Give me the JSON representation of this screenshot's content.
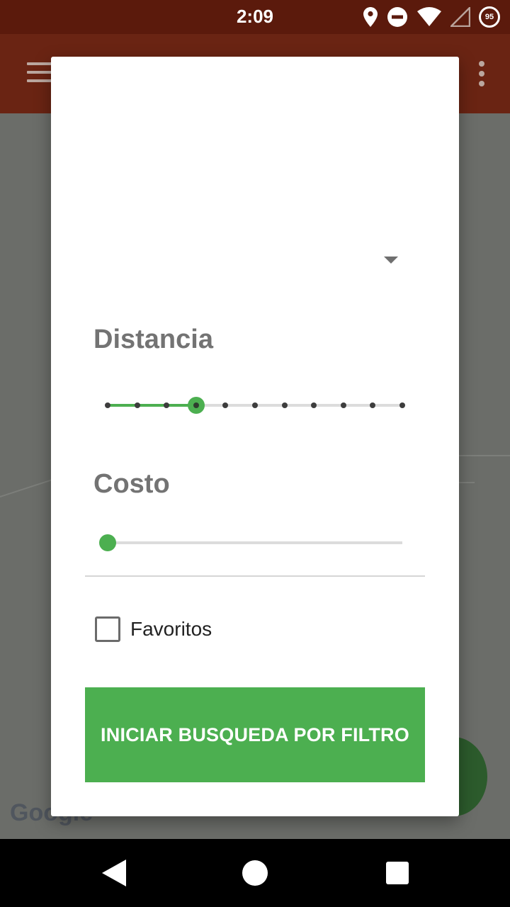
{
  "status_bar": {
    "time": "2:09",
    "icons": [
      "location-icon",
      "do-not-disturb-icon",
      "wifi-icon",
      "cell-signal-icon",
      "battery-icon"
    ],
    "battery_level": "95"
  },
  "app_bar": {
    "menu_icon": "menu-icon",
    "overflow_icon": "more-vert-icon"
  },
  "map": {
    "logo": "Google"
  },
  "dialog": {
    "spinner_icon": "arrow-drop-down-icon",
    "distancia": {
      "label": "Distancia",
      "steps": 11,
      "selected_index": 3
    },
    "costo": {
      "label": "Costo",
      "value_fraction": 0
    },
    "favoritos": {
      "label": "Favoritos",
      "checked": false
    },
    "search_button_label": "INICIAR BUSQUEDA POR FILTRO"
  },
  "nav_bar": {
    "icons": [
      "back-icon",
      "home-icon",
      "recents-icon"
    ]
  },
  "colors": {
    "status_bar": "#5b1a0c",
    "app_bar": "#6a2413",
    "accent": "#4caf50",
    "label_gray": "#737373"
  }
}
